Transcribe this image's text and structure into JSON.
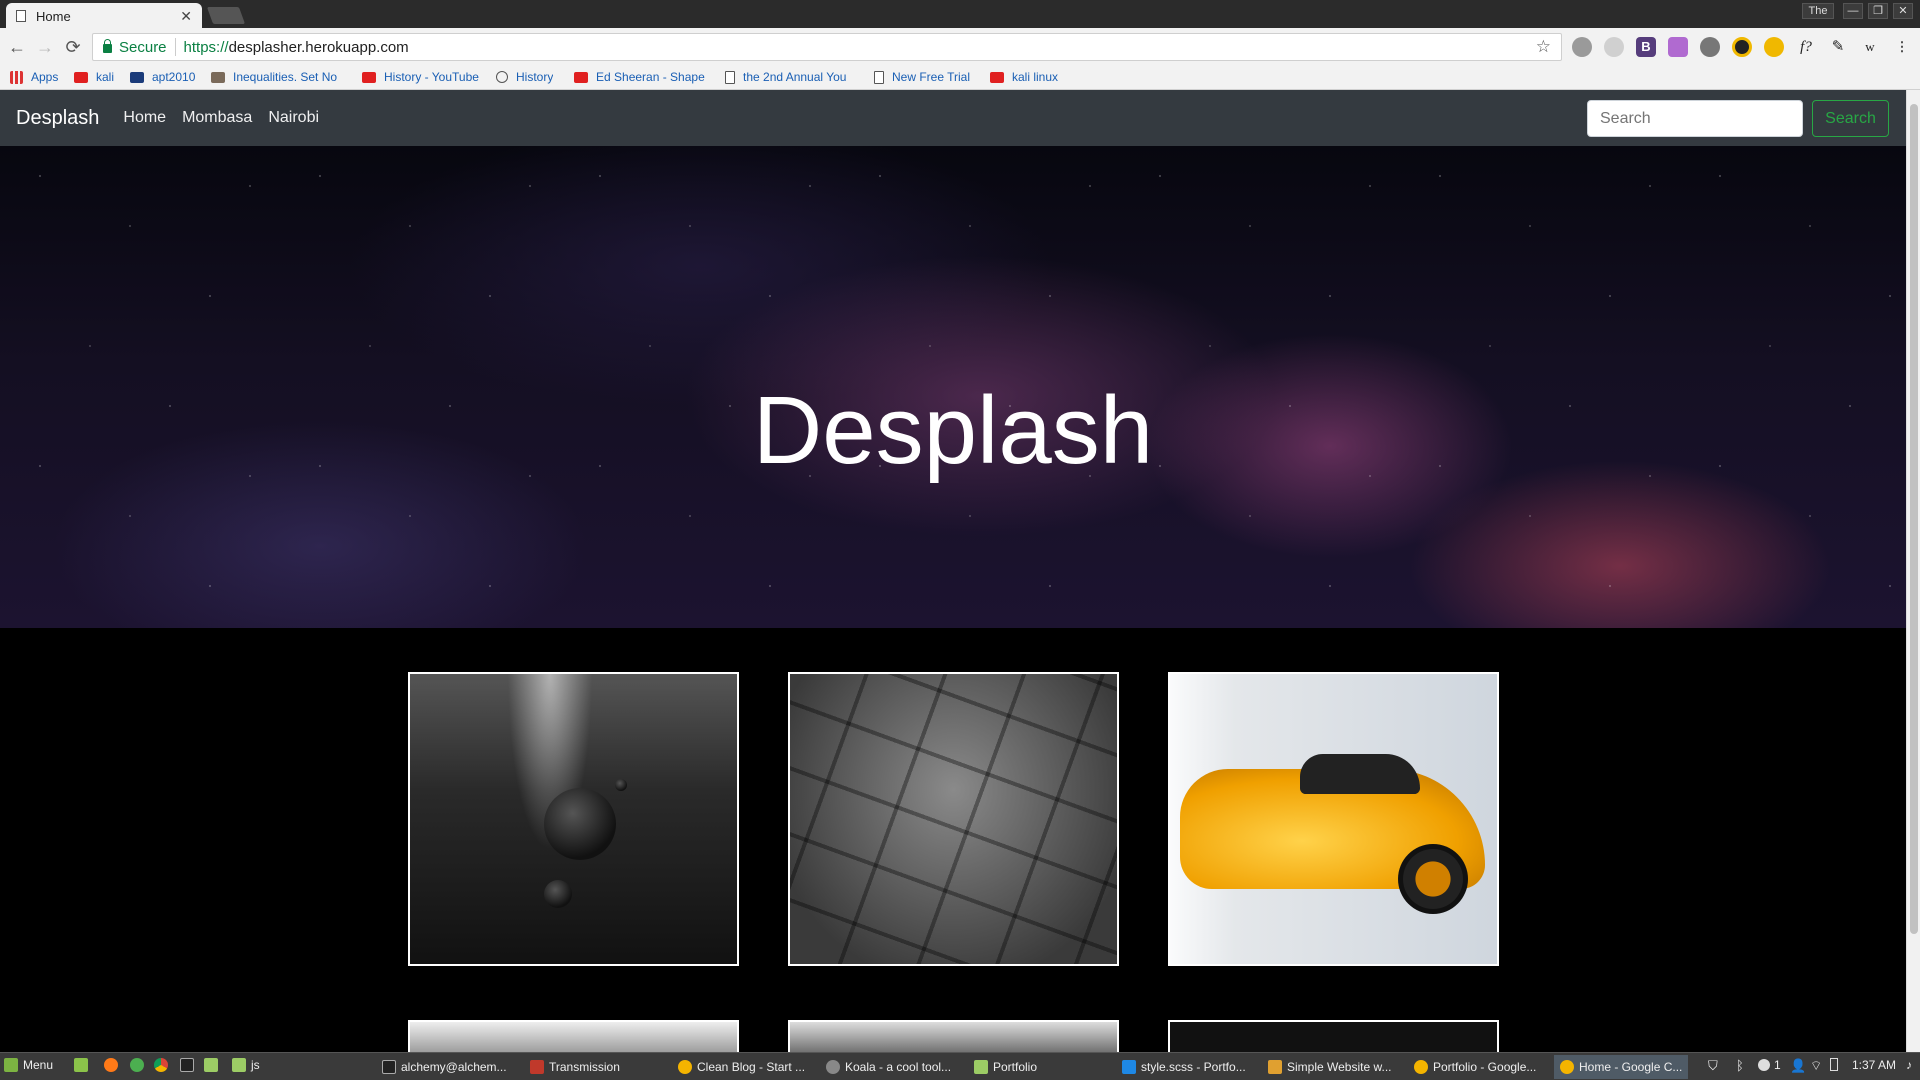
{
  "browser": {
    "tab": {
      "title": "Home"
    },
    "window_controls": {
      "user": "The"
    },
    "address": {
      "secure_label": "Secure",
      "scheme": "https://",
      "host": "desplasher.herokuapp.com"
    },
    "bookmarks": [
      "Apps",
      "kali",
      "apt2010",
      "Inequalities. Set No",
      "History - YouTube",
      "History",
      "Ed Sheeran - Shape",
      "the 2nd Annual You",
      "New Free Trial",
      "kali linux"
    ],
    "extensions": [
      "circle-ext-icon",
      "circle-ext-icon-2",
      "bootstrap-ext-icon",
      "wand-ext-icon",
      "bug-ext-icon",
      "smile-ext-icon",
      "moon-ext-icon",
      "font-ext-icon",
      "eyedropper-ext-icon",
      "w-ext-icon"
    ],
    "extension_labels": {
      "bootstrap": "B",
      "font": "f?",
      "w": "w"
    }
  },
  "site": {
    "brand": "Desplash",
    "nav": [
      "Home",
      "Mombasa",
      "Nairobi"
    ],
    "search": {
      "placeholder": "Search",
      "button": "Search"
    },
    "hero_title": "Desplash",
    "gallery": [
      "planets-image",
      "stone-texture-image",
      "yellow-car-image"
    ]
  },
  "taskbar": {
    "menu": "Menu",
    "folder": "js",
    "windows": [
      "alchemy@alchem...",
      "Transmission",
      "Clean Blog - Start ...",
      "Koala - a cool tool...",
      "Portfolio",
      "style.scss - Portfo...",
      "Simple Website w...",
      "Portfolio - Google...",
      "Home - Google C..."
    ],
    "tray": {
      "updates": "1",
      "time": "1:37 AM"
    }
  },
  "colors": {
    "navbar": "#343a40",
    "search_green": "#28a745",
    "secure_green": "#0b8043",
    "bookmark_blue": "#1a5fb4"
  }
}
